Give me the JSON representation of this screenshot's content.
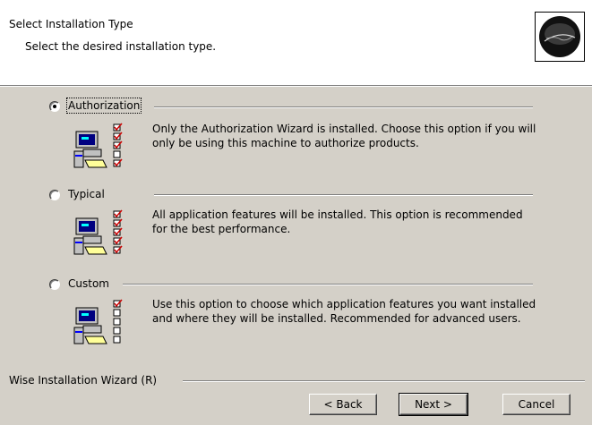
{
  "header": {
    "title": "Select Installation Type",
    "subtitle": "Select the desired installation type.",
    "logo_icon": "installer-logo"
  },
  "options": [
    {
      "label": "Authorization",
      "selected": true,
      "description": "Only the Authorization Wizard is installed. Choose this option if you will only be using this machine to authorize products.",
      "icon": "computer-features-icon"
    },
    {
      "label": "Typical",
      "selected": false,
      "description": "All application features will be installed. This option is recommended for the best performance.",
      "icon": "computer-features-icon"
    },
    {
      "label": "Custom",
      "selected": false,
      "description": "Use this option to choose which application features you want installed and where they will be installed. Recommended for advanced users.",
      "icon": "computer-features-icon"
    }
  ],
  "footer": {
    "brand": "Wise Installation Wizard (R)",
    "back_label": "< Back",
    "next_label": "Next >",
    "cancel_label": "Cancel"
  },
  "colors": {
    "dialog_bg": "#d4d0c8",
    "header_bg": "#ffffff",
    "check_red": "#cc0000"
  }
}
